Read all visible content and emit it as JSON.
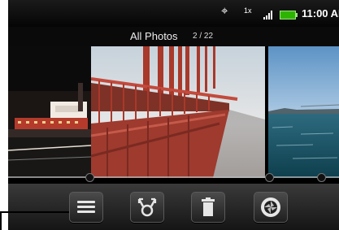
{
  "status": {
    "time": "11:00 AM",
    "icons": [
      "gps-icon",
      "network-1x-icon",
      "signal-icon",
      "battery-icon"
    ],
    "network_label": "1x",
    "battery_color": "#2db400"
  },
  "header": {
    "title": "All Photos",
    "counter": "2 / 22"
  },
  "gallery": {
    "photos": [
      {
        "name": "night-city-photo"
      },
      {
        "name": "golden-gate-bridge-photo"
      },
      {
        "name": "bay-water-photo"
      }
    ]
  },
  "toolbar": {
    "buttons": [
      {
        "name": "menu-button",
        "icon": "menu-icon"
      },
      {
        "name": "share-button",
        "icon": "share-icon"
      },
      {
        "name": "delete-button",
        "icon": "trash-icon"
      },
      {
        "name": "camera-button",
        "icon": "camera-shutter-icon"
      }
    ]
  },
  "colors": {
    "background": "#000000",
    "toolbar_top": "#3a3a3a",
    "toolbar_bottom": "#151515",
    "bridge_red": "#a8392b",
    "sky_right": "#86b2d6"
  }
}
